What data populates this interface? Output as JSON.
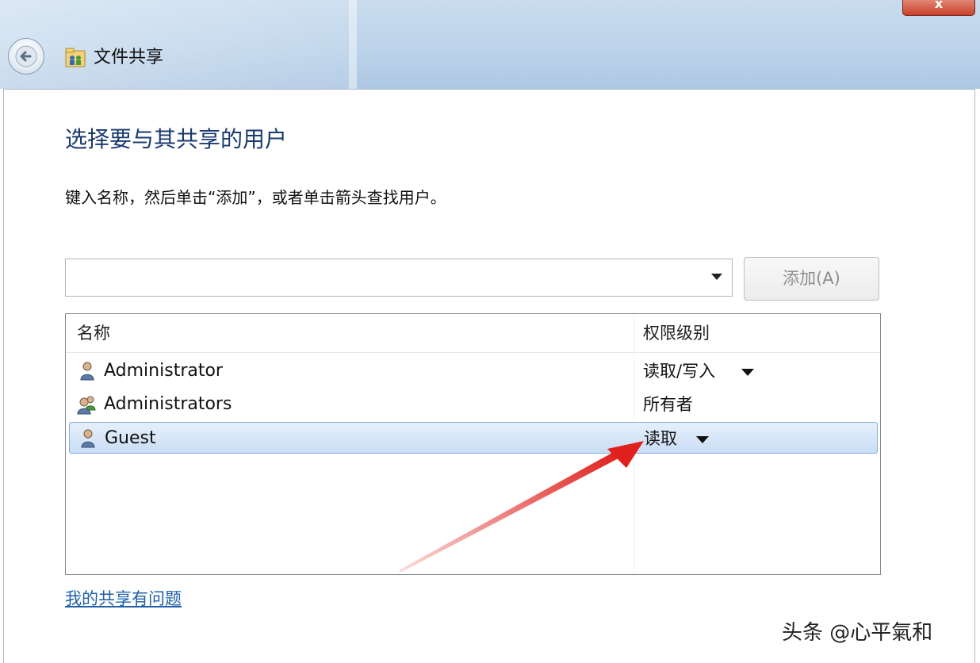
{
  "window": {
    "title": "文件共享",
    "close_label": "x",
    "icons": {
      "back": "back-arrow-icon",
      "app": "file-sharing-icon",
      "close": "close-icon"
    }
  },
  "main": {
    "heading": "选择要与其共享的用户",
    "instructions": "键入名称，然后单击“添加”，或者单击箭头查找用户。",
    "user_input": {
      "value": "",
      "placeholder": ""
    },
    "add_button": "添加(A)"
  },
  "table": {
    "headers": {
      "name": "名称",
      "permission": "权限级别"
    },
    "rows": [
      {
        "name": "Administrator",
        "permission": "读取/写入",
        "icon": "user-icon",
        "has_dropdown": true,
        "selected": false
      },
      {
        "name": "Administrators",
        "permission": "所有者",
        "icon": "user-group-icon",
        "has_dropdown": false,
        "selected": false
      },
      {
        "name": "Guest",
        "permission": "读取",
        "icon": "user-icon",
        "has_dropdown": true,
        "selected": true
      }
    ]
  },
  "footer": {
    "help_link": "我的共享有问题",
    "watermark": "头条 @心平氣和"
  },
  "colors": {
    "heading": "#1a3a6e",
    "link": "#1f5fa8",
    "selection": "#c9ddf4",
    "annotation_arrow": "#e0201c"
  }
}
